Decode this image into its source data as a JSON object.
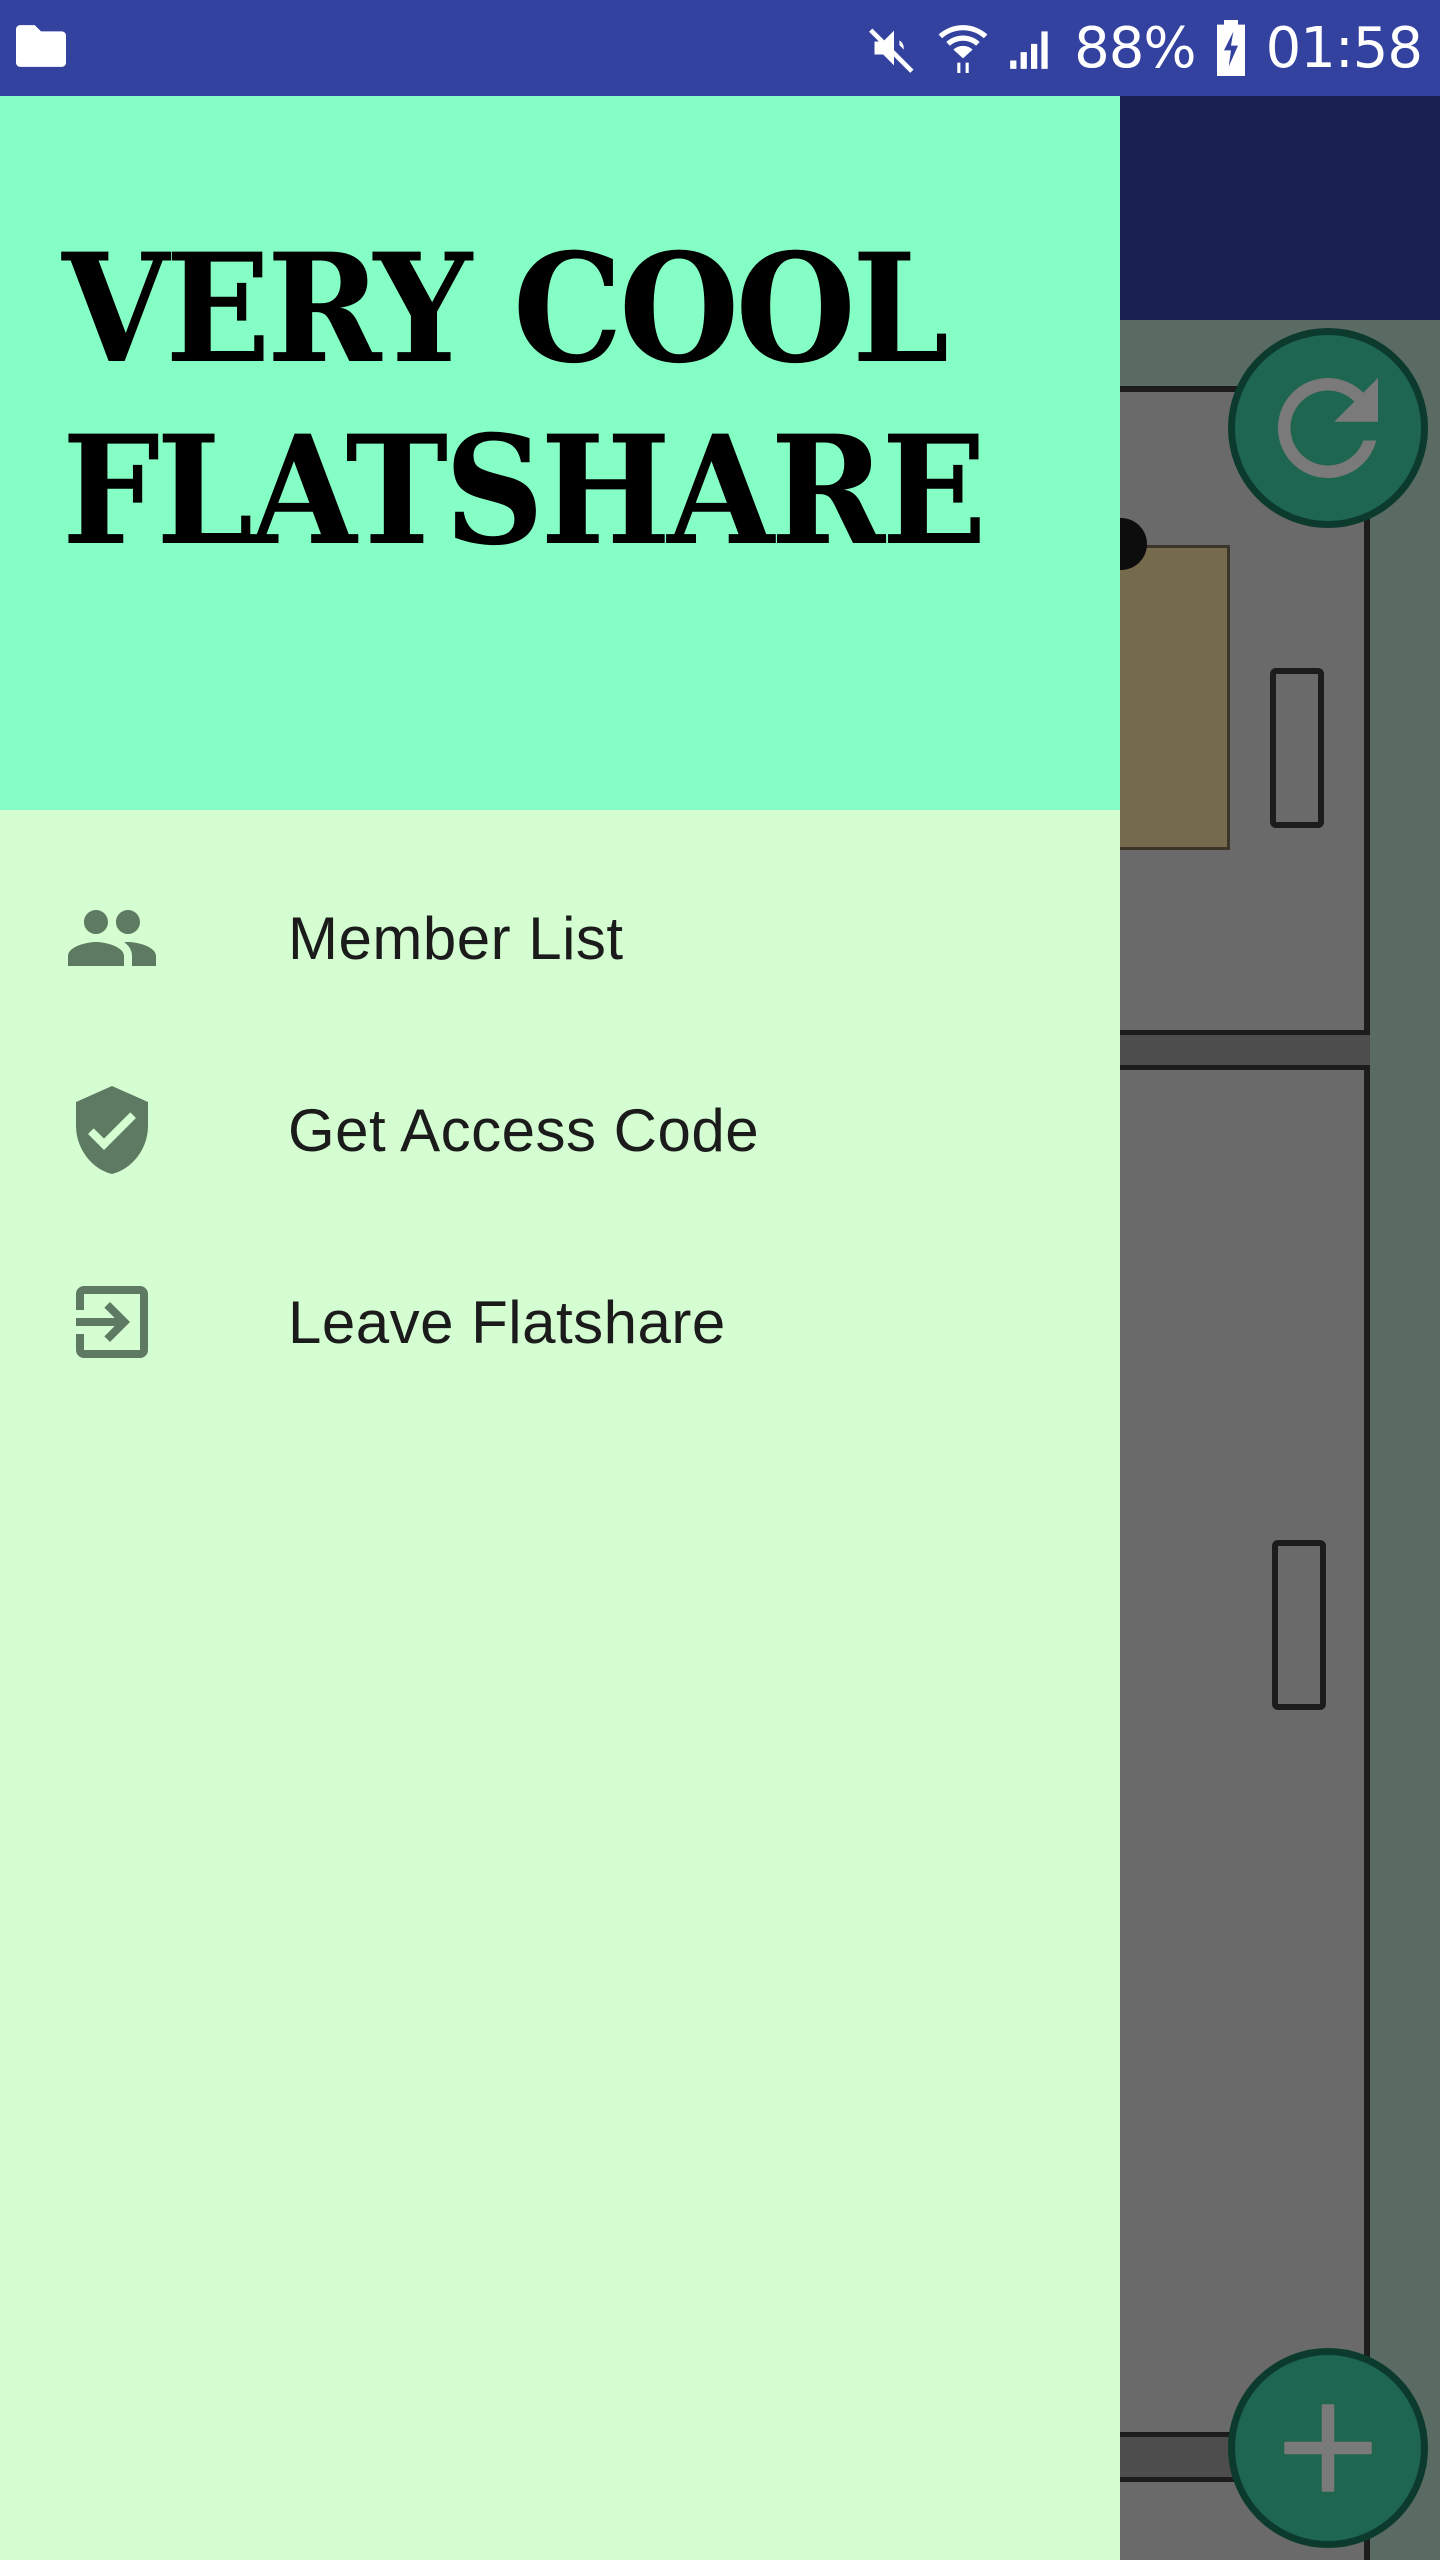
{
  "status_bar": {
    "battery": "88%",
    "time": "01:58",
    "icons": [
      "folder-icon",
      "mute-icon",
      "wifi-icon",
      "signal-icon",
      "battery-charging-icon"
    ]
  },
  "drawer": {
    "title": "VERY COOL FLATSHARE",
    "items": [
      {
        "label": "Member List",
        "icon": "group-icon"
      },
      {
        "label": "Get Access Code",
        "icon": "verified-shield-icon"
      },
      {
        "label": "Leave Flatshare",
        "icon": "exit-to-app-icon"
      }
    ]
  },
  "background": {
    "fab_refresh_icon": "refresh-icon",
    "fab_add_icon": "add-icon"
  },
  "colors": {
    "status_bar": "#33419f",
    "drawer_header": "#85fec5",
    "drawer_body": "#d4fdd1",
    "icon_tint": "#5f7a62",
    "fab": "#1e6650"
  }
}
